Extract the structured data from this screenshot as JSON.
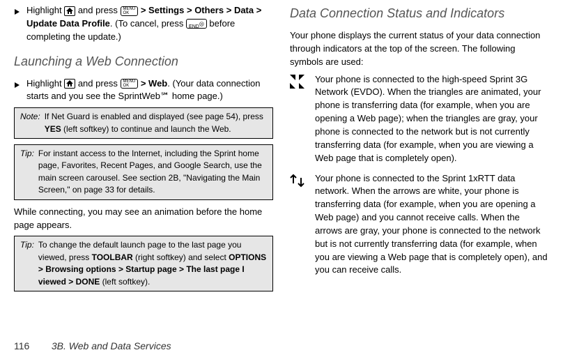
{
  "left": {
    "bullet1": {
      "pre": "Highlight ",
      "mid1": " and press ",
      "menu_ok": "MENU OK",
      "path": " > Settings > Others > Data > Update Data Profile",
      "path_parts": [
        "Settings",
        "Others",
        "Data",
        "Update Data Profile"
      ],
      "post1": ". (To cancel, press ",
      "end_icon": "END",
      "post2": " before completing the update.)"
    },
    "heading1": "Launching a Web Connection",
    "bullet2": {
      "pre": "Highlight ",
      "mid1": " and press ",
      "menu_ok": "MENU OK",
      "path": " > Web",
      "post": ". (Your data connection starts and you see the SprintWeb℠ home page.)"
    },
    "note1": {
      "label": "Note:",
      "text_pre": "If Net Guard is enabled and displayed (see page 54), press ",
      "yes": "YES",
      "text_post": " (left softkey) to continue and launch the Web."
    },
    "tip1": {
      "label": "Tip:",
      "text": "For instant access to the Internet, including the Sprint home page, Favorites, Recent Pages, and Google Search, use the main screen carousel. See section 2B, \"Navigating the Main Screen,\" on page 33 for details."
    },
    "para1": "While connecting, you may see an animation before the home page appears.",
    "tip2": {
      "label": "Tip:",
      "text_pre": "To change the default launch page to the last page you viewed, press ",
      "toolbar": "TOOLBAR",
      "text_mid1": " (right softkey) and select ",
      "options": "OPTIONS",
      "browsing": "Browsing options",
      "startup": "Startup page",
      "lastpage": "The last page I viewed",
      "done": "DONE",
      "text_post": " (left softkey)."
    }
  },
  "right": {
    "heading2": "Data Connection Status and Indicators",
    "para2": "Your phone displays the current status of your data connection through indicators at the top of the screen. The following symbols are used:",
    "status1": "Your phone is connected to the high-speed Sprint 3G Network (EVDO). When the triangles are animated, your phone is transferring data (for example, when you are opening a Web page); when the triangles are gray, your phone is connected to the network but is not currently transferring data (for example, when you are viewing a Web page that is completely open).",
    "status2": "Your phone is connected to the Sprint 1xRTT data network. When the arrows are white, your phone is transferring data (for example, when you are opening a Web page) and you cannot receive calls. When the arrows are gray, your phone is connected to the network but is not currently transferring data (for example, when you are viewing a Web page that is completely open), and you can receive calls."
  },
  "footer": {
    "page_number": "116",
    "section": "3B. Web and Data Services"
  }
}
